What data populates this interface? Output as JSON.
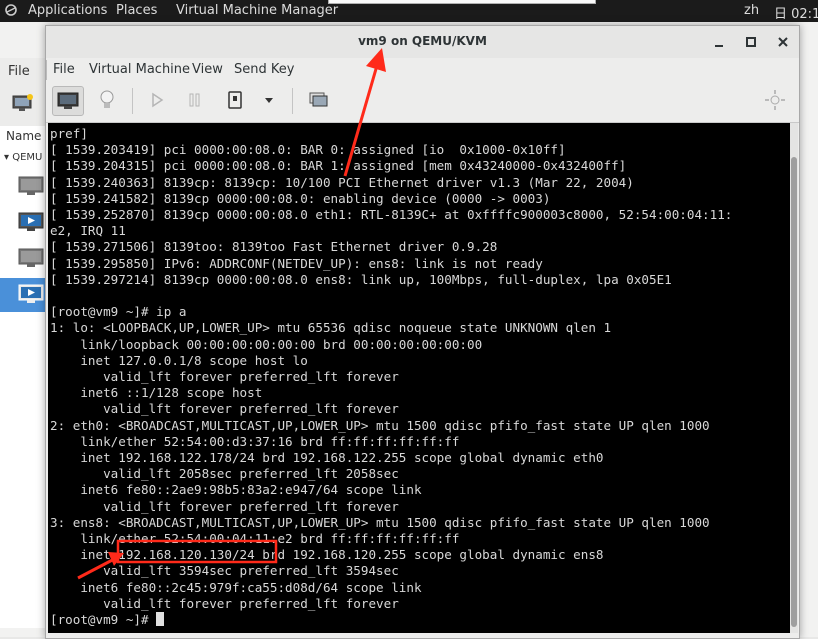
{
  "topbar": {
    "applications": "Applications",
    "places": "Places",
    "app_name": "Virtual Machine Manager",
    "lang": "zh",
    "clock": "日 02:1"
  },
  "bg_window": {
    "menu_file": "File",
    "list_header": "Name",
    "group_label": "QEMU"
  },
  "vm_window": {
    "title": "vm9 on QEMU/KVM",
    "menus": [
      "File",
      "Virtual Machine",
      "View",
      "Send Key"
    ]
  },
  "console": {
    "lines": [
      "pref]",
      "[ 1539.203419] pci 0000:00:08.0: BAR 0: assigned [io  0x1000-0x10ff]",
      "[ 1539.204315] pci 0000:00:08.0: BAR 1: assigned [mem 0x43240000-0x432400ff]",
      "[ 1539.240363] 8139cp: 8139cp: 10/100 PCI Ethernet driver v1.3 (Mar 22, 2004)",
      "[ 1539.241582] 8139cp 0000:00:08.0: enabling device (0000 -> 0003)",
      "[ 1539.252870] 8139cp 0000:00:08.0 eth1: RTL-8139C+ at 0xffffc900003c8000, 52:54:00:04:11:",
      "e2, IRQ 11",
      "[ 1539.271506] 8139too: 8139too Fast Ethernet driver 0.9.28",
      "[ 1539.295850] IPv6: ADDRCONF(NETDEV_UP): ens8: link is not ready",
      "[ 1539.297214] 8139cp 0000:00:08.0 ens8: link up, 100Mbps, full-duplex, lpa 0x05E1",
      "",
      "[root@vm9 ~]# ip a",
      "1: lo: <LOOPBACK,UP,LOWER_UP> mtu 65536 qdisc noqueue state UNKNOWN qlen 1",
      "    link/loopback 00:00:00:00:00:00 brd 00:00:00:00:00:00",
      "    inet 127.0.0.1/8 scope host lo",
      "       valid_lft forever preferred_lft forever",
      "    inet6 ::1/128 scope host",
      "       valid_lft forever preferred_lft forever",
      "2: eth0: <BROADCAST,MULTICAST,UP,LOWER_UP> mtu 1500 qdisc pfifo_fast state UP qlen 1000",
      "    link/ether 52:54:00:d3:37:16 brd ff:ff:ff:ff:ff:ff",
      "    inet 192.168.122.178/24 brd 192.168.122.255 scope global dynamic eth0",
      "       valid_lft 2058sec preferred_lft 2058sec",
      "    inet6 fe80::2ae9:98b5:83a2:e947/64 scope link",
      "       valid_lft forever preferred_lft forever",
      "3: ens8: <BROADCAST,MULTICAST,UP,LOWER_UP> mtu 1500 qdisc pfifo_fast state UP qlen 1000",
      "    link/ether 52:54:00:04:11:e2 brd ff:ff:ff:ff:ff:ff",
      "    inet 192.168.120.130/24 brd 192.168.120.255 scope global dynamic ens8",
      "       valid_lft 3594sec preferred_lft 3594sec",
      "    inet6 fe80::2c45:979f:ca55:d08d/64 scope link",
      "       valid_lft forever preferred_lft forever",
      "[root@vm9 ~]# "
    ]
  },
  "annotations": {
    "color": "#ff2a1a"
  }
}
